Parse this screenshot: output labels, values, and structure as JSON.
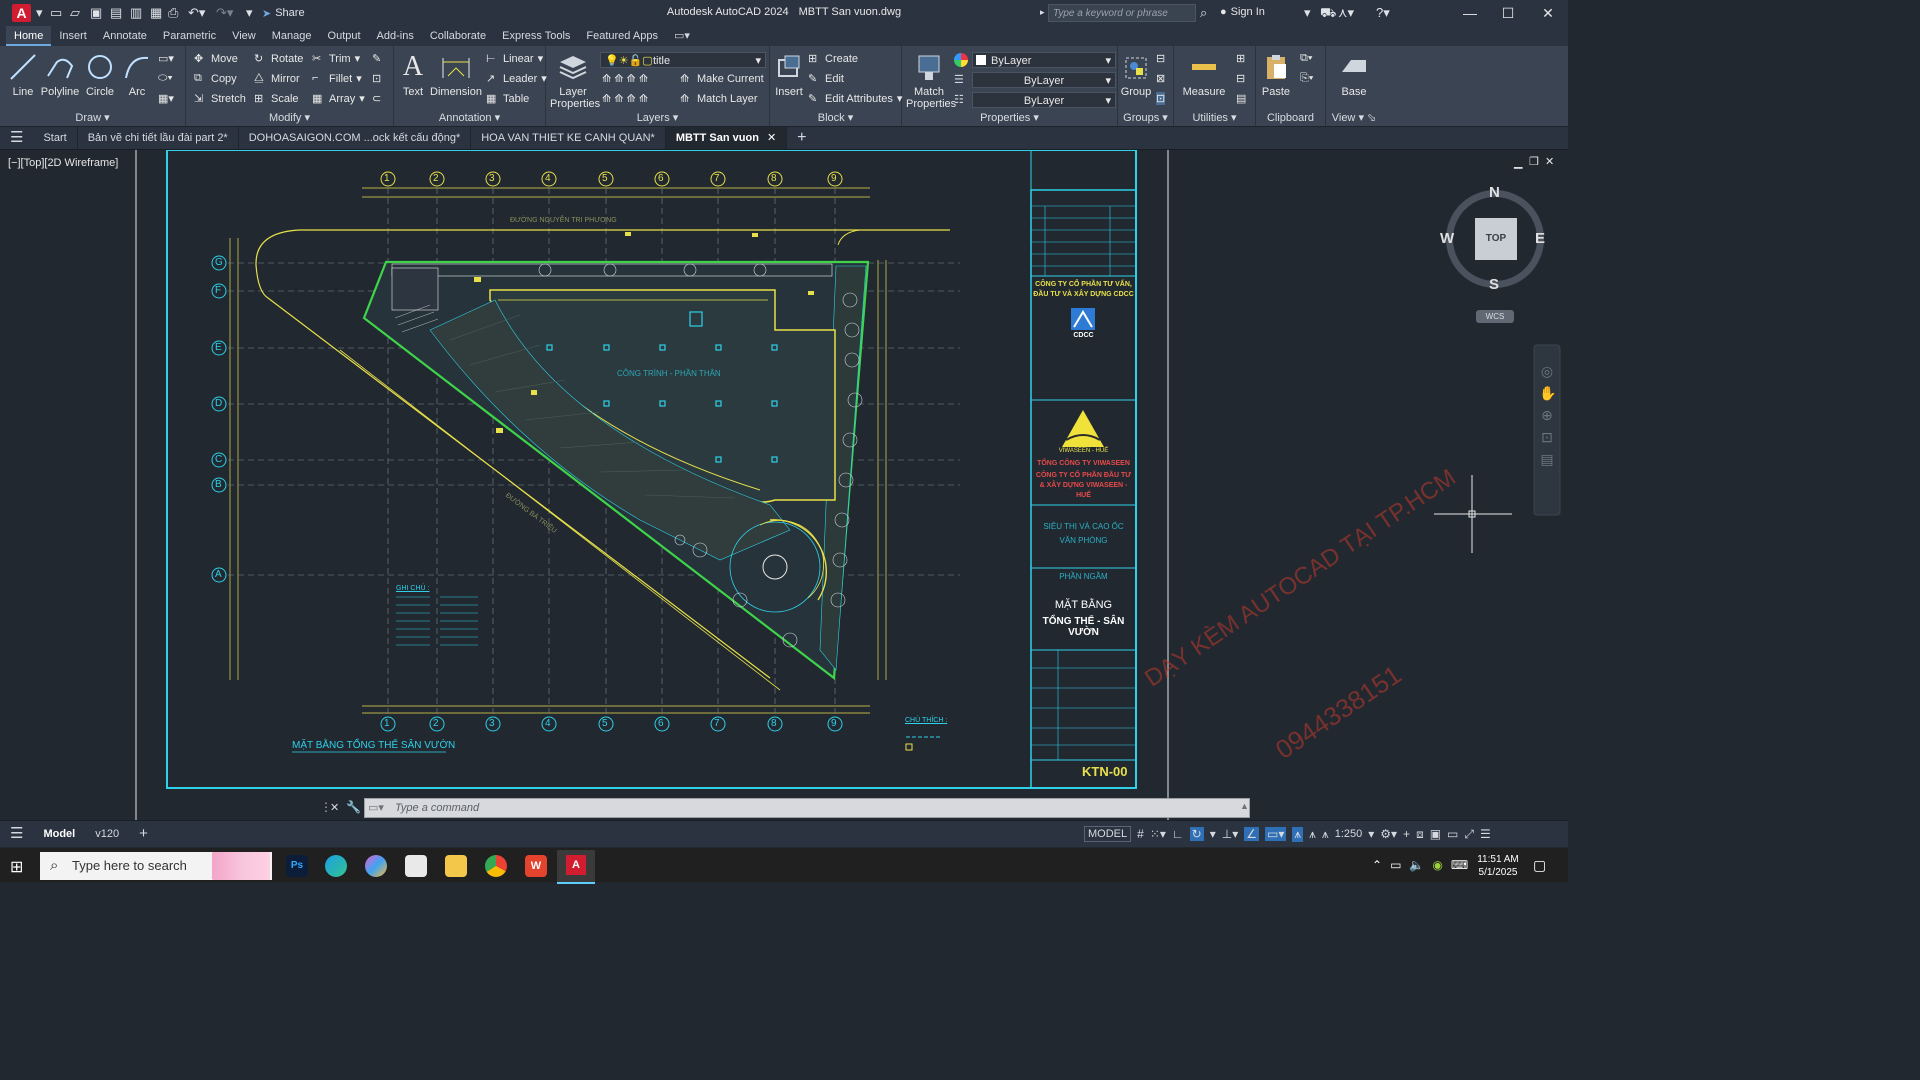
{
  "app": {
    "title": "Autodesk AutoCAD 2024",
    "document": "MBTT San vuon.dwg",
    "logo": "A",
    "share_label": "Share",
    "search_placeholder": "Type a keyword or phrase",
    "sign_in": "Sign In"
  },
  "ribbon_tabs": [
    "Home",
    "Insert",
    "Annotate",
    "Parametric",
    "View",
    "Manage",
    "Output",
    "Add-ins",
    "Collaborate",
    "Express Tools",
    "Featured Apps"
  ],
  "ribbon": {
    "draw": {
      "title": "Draw",
      "line": "Line",
      "polyline": "Polyline",
      "circle": "Circle",
      "arc": "Arc"
    },
    "modify": {
      "title": "Modify",
      "move": "Move",
      "rotate": "Rotate",
      "trim": "Trim",
      "copy": "Copy",
      "mirror": "Mirror",
      "fillet": "Fillet",
      "stretch": "Stretch",
      "scale": "Scale",
      "array": "Array"
    },
    "annotation": {
      "title": "Annotation",
      "text": "Text",
      "dimension": "Dimension",
      "linear": "Linear",
      "leader": "Leader",
      "table": "Table"
    },
    "layers": {
      "title": "Layers",
      "layer_properties": "Layer Properties",
      "current_layer": "title",
      "make_current": "Make Current",
      "match_layer": "Match Layer"
    },
    "block": {
      "title": "Block",
      "insert": "Insert",
      "create": "Create",
      "edit": "Edit",
      "edit_attributes": "Edit Attributes"
    },
    "properties": {
      "title": "Properties",
      "match_properties": "Match Properties",
      "color": "ByLayer",
      "lineweight": "ByLayer",
      "linetype": "ByLayer"
    },
    "groups": {
      "title": "Groups",
      "group": "Group"
    },
    "utilities": {
      "title": "Utilities",
      "measure": "Measure"
    },
    "clipboard": {
      "title": "Clipboard",
      "paste": "Paste"
    },
    "view": {
      "title": "View",
      "base": "Base"
    }
  },
  "file_tabs": [
    "Start",
    "Bản vẽ chi tiết lầu đài part 2*",
    "DOHOASAIGON.COM ...ock kết cấu động*",
    "HOA VAN THIET KE CANH QUAN*",
    "MBTT San vuon"
  ],
  "active_file_tab": "MBTT San vuon",
  "viewport_label": "[−][Top][2D Wireframe]",
  "viewcube": {
    "n": "N",
    "s": "S",
    "e": "E",
    "w": "W",
    "top": "TOP",
    "wcs": "WCS"
  },
  "drawing": {
    "grid_cols": [
      "1",
      "2",
      "3",
      "4",
      "5",
      "6",
      "7",
      "8",
      "9"
    ],
    "grid_rows": [
      "G",
      "F",
      "E",
      "D",
      "C",
      "B",
      "A"
    ],
    "street_top": "ĐƯỜNG NGUYỄN TRI PHƯƠNG",
    "street_diag": "ĐƯỜNG BÀ TRIỆU",
    "building_label": "CÔNG TRÌNH - PHẦN THÂN",
    "plan_title": "MẶT BẰNG TỔNG THỂ SÂN VƯỜN",
    "notes_title": "GHI CHÚ :",
    "legend_title": "CHÚ THÍCH :",
    "title_block": {
      "company1": "CÔNG TY CỔ PHẦN TƯ VẤN, ĐẦU TƯ VÀ XÂY DỰNG CDCC",
      "company1_logo": "CDCC",
      "company2_logo": "VIWASEEN - HUẾ",
      "company2": "TỔNG CÔNG TY VIWASEEN",
      "company2b": "CÔNG TY CỔ PHẦN ĐẦU TƯ & XÂY DỰNG VIWASEEN - HUẾ",
      "project": "SIÊU THỊ VÀ CAO ỐC VĂN PHÒNG",
      "phase": "PHẦN NGẦM",
      "sheet_title1": "MẶT BẰNG",
      "sheet_title2": "TỔNG THỂ - SÂN VƯỜN",
      "sheet_no": "KTN-00"
    },
    "watermark1": "DẠY KÈM AUTOCAD TẠI TP.HCM",
    "watermark2": "0944338151"
  },
  "command_placeholder": "Type a command",
  "layout_tabs": [
    "Model",
    "v120"
  ],
  "status": {
    "model": "MODEL",
    "scale": "1:250"
  },
  "taskbar": {
    "search": "Type here to search",
    "time": "11:51 AM",
    "date": "5/1/2025"
  },
  "colors": {
    "accent": "#6fa8dc",
    "drawing_bg": "#212830",
    "green": "#3ed44a",
    "yellow": "#e8e04a",
    "cyan": "#2ed1e8"
  }
}
